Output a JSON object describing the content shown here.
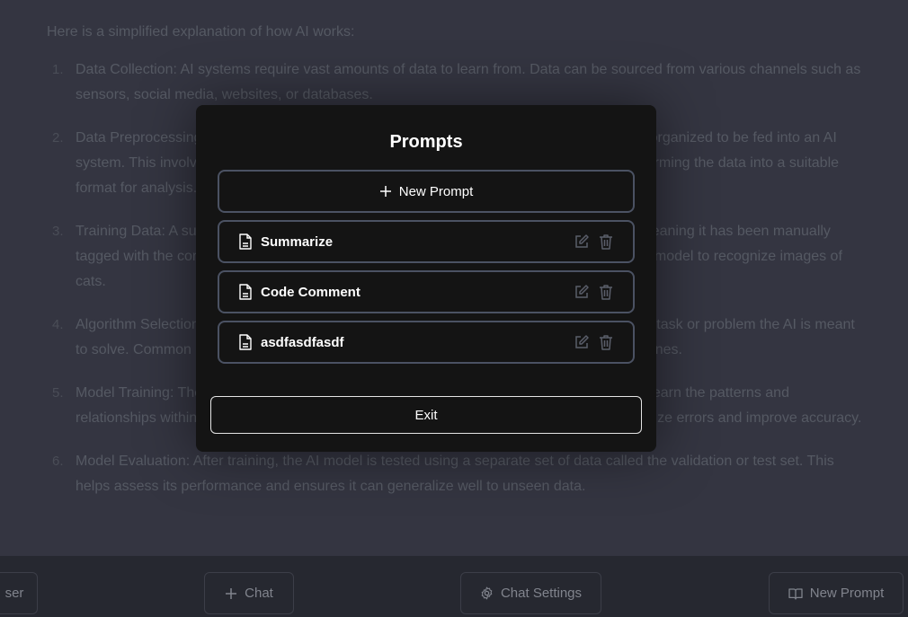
{
  "chat": {
    "intro": "Here is a simplified explanation of how AI works:",
    "items": [
      {
        "num": "1.",
        "text": "Data Collection: AI systems require vast amounts of data to learn from. Data can be sourced from various channels such as sensors, social media, websites, or databases."
      },
      {
        "num": "2.",
        "text": "Data Preprocessing: Before data can be fed into an AI system, it needs to be cleaned and organized to be fed into an AI system. This involves removing irrelevant information, handling missing values, and transforming the data into a suitable format for analysis."
      },
      {
        "num": "3.",
        "text": "Training Data: A subset of the data is used for training, where each data point is labeled, meaning it has been manually tagged with the correct output the AI should learn to predict from. For example, if training a model to recognize images of cats."
      },
      {
        "num": "4.",
        "text": "Algorithm Selection: The appropriate AI algorithm or model is chosen based on the specific task or problem the AI is meant to solve. Common algorithms include decision trees, neural networks, support vector machines."
      },
      {
        "num": "5.",
        "text": "Model Training: The prepared data is fed into the chosen model, allowing the AI system to learn the patterns and relationships within the data. The system adjusts its internal parameters iteratively to minimize errors and improve accuracy."
      },
      {
        "num": "6.",
        "text": "Model Evaluation: After training, the AI model is tested using a separate set of data called the validation or test set. This helps assess its performance and ensures it can generalize well to unseen data."
      }
    ]
  },
  "bottom_bar": {
    "user_label": "ser",
    "chat_label": "Chat",
    "chat_settings_label": "Chat Settings",
    "new_prompt_label": "New Prompt"
  },
  "modal": {
    "title": "Prompts",
    "new_prompt_label": "New Prompt",
    "prompts": [
      {
        "label": "Summarize"
      },
      {
        "label": "Code Comment"
      },
      {
        "label": "asdfasdfasdf"
      }
    ],
    "exit_label": "Exit"
  },
  "colors": {
    "page_bg": "#343541",
    "modal_bg": "#141414",
    "border": "#4b5263",
    "text_light": "#ffffff",
    "icon_muted": "#5a5e6a"
  },
  "icons": {
    "plus": "plus-icon",
    "document": "document-icon",
    "edit": "edit-icon",
    "trash": "trash-icon",
    "gear": "gear-icon",
    "book": "book-icon"
  }
}
